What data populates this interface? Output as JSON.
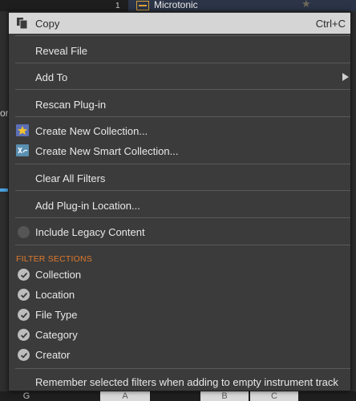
{
  "background": {
    "counter": "1",
    "plugin_name": "Microtonic",
    "left_fragment": "or",
    "keys": [
      "G",
      "A",
      "B",
      "C"
    ]
  },
  "colors": {
    "menu_bg": "#3b3b3b",
    "highlight_bg": "#d5d5d5",
    "section_header": "#e07a2c",
    "separator": "#5a5a5a"
  },
  "menu": {
    "copy": {
      "label": "Copy",
      "shortcut": "Ctrl+C",
      "icon": "copy-icon"
    },
    "reveal_file": "Reveal File",
    "add_to": "Add To",
    "rescan_plugin": "Rescan Plug-in",
    "create_collection": {
      "label": "Create New Collection...",
      "icon": "collection-star-icon"
    },
    "create_smart_collection": {
      "label": "Create New Smart Collection...",
      "icon": "smart-collection-icon"
    },
    "clear_filters": "Clear All Filters",
    "add_plugin_location": "Add Plug-in Location...",
    "include_legacy": {
      "label": "Include Legacy Content",
      "checked": false
    },
    "filter_sections": {
      "header": "FILTER SECTIONS",
      "items": [
        {
          "label": "Collection",
          "checked": true
        },
        {
          "label": "Location",
          "checked": true
        },
        {
          "label": "File Type",
          "checked": true
        },
        {
          "label": "Category",
          "checked": true
        },
        {
          "label": "Creator",
          "checked": true
        }
      ]
    },
    "remember_filters": "Remember selected filters when adding to empty instrument track"
  }
}
